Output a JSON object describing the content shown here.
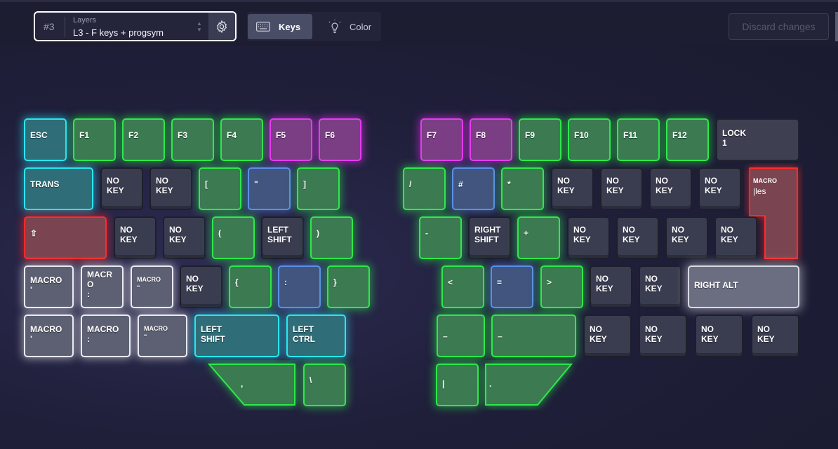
{
  "layer": {
    "number": "#3",
    "caption": "Layers",
    "name": "L3 - F keys + progsym"
  },
  "tabs": {
    "keys": "Keys",
    "color": "Color"
  },
  "discard_label": "Discard changes",
  "colors": {
    "cyan": "#29e7ef",
    "green": "#2fe84a",
    "magenta": "#e53cf0",
    "blue": "#5b8fe6",
    "red": "#ff2b2b",
    "white": "#e9eaf2"
  },
  "left_keys": {
    "esc": "ESC",
    "f1": "F1",
    "f2": "F2",
    "f3": "F3",
    "f4": "F4",
    "f5": "F5",
    "f6": "F6",
    "trans": "TRANS",
    "nokey_a": "NO\nKEY",
    "nokey_b": "NO\nKEY",
    "lbracket": "[",
    "dquote": "\"",
    "rbracket": "]",
    "shift_up": "⇧",
    "nokey_c": "NO\nKEY",
    "nokey_d": "NO\nKEY",
    "lparen": "(",
    "left_shift_1": "LEFT\nSHIFT",
    "rparen": ")",
    "macro_1": "MACRO\n'",
    "macro_2": "MACR\nO\n:",
    "macro_3": "MACRO\n\"",
    "nokey_e": "NO\nKEY",
    "lbrace": "{",
    "colon": ":",
    "rbrace": "}",
    "macro_4": "MACRO\n'",
    "macro_5": "MACRO\n:",
    "macro_6": "MACRO\n\"",
    "left_shift_2": "LEFT\nSHIFT",
    "left_ctrl": "LEFT\nCTRL",
    "comma": ",",
    "backslash": "\\"
  },
  "right_keys": {
    "f7": "F7",
    "f8": "F8",
    "f9": "F9",
    "f10": "F10",
    "f11": "F11",
    "f12": "F12",
    "lock": "LOCK\n1",
    "slash": "/",
    "hash": "#",
    "star": "*",
    "nokey_1": "NO\nKEY",
    "nokey_2": "NO\nKEY",
    "nokey_3": "NO\nKEY",
    "nokey_4": "NO\nKEY",
    "macro_caption": "MACRO",
    "macro_value": "|les",
    "minus": "-",
    "right_shift": "RIGHT\nSHIFT",
    "plus": "+",
    "nokey_5": "NO\nKEY",
    "nokey_6": "NO\nKEY",
    "nokey_7": "NO\nKEY",
    "nokey_8": "NO\nKEY",
    "less": "<",
    "equals": "=",
    "greater": ">",
    "nokey_9": "NO\nKEY",
    "nokey_10": "NO\nKEY",
    "right_alt": "RIGHT ALT",
    "under_1": "–",
    "under_2": "–",
    "nokey_11": "NO\nKEY",
    "nokey_12": "NO\nKEY",
    "nokey_13": "NO\nKEY",
    "nokey_14": "NO\nKEY",
    "pipe": "|",
    "period": "."
  }
}
